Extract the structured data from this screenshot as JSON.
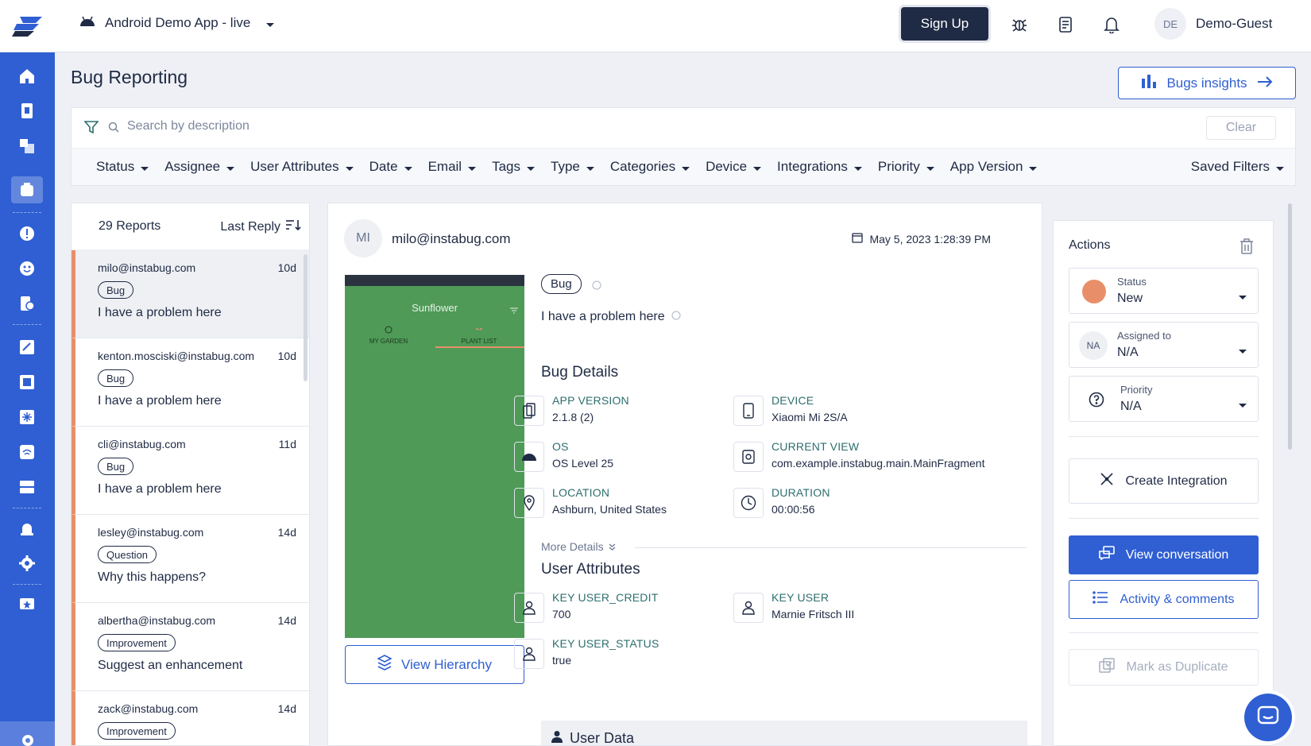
{
  "topbar": {
    "app_name": "Android Demo App - live",
    "signup_label": "Sign Up",
    "user_initials": "DE",
    "user_name": "Demo-Guest",
    "icons": [
      "bug-icon",
      "document-icon",
      "bell-icon"
    ]
  },
  "sidebar": {
    "items": [
      "home-icon",
      "report-icon",
      "copy-icon",
      "bug-reporting-icon",
      "crash-icon",
      "surveys-icon",
      "feature-requests-icon",
      "releases-icon",
      "apm-icon",
      "network-icon",
      "wifi-icon",
      "dashboard-icon",
      "alerts-icon",
      "settings-icon",
      "announcements-icon"
    ],
    "active": "bug-reporting-icon"
  },
  "header": {
    "title": "Bug Reporting",
    "insights_label": "Bugs insights"
  },
  "search": {
    "placeholder": "Search by description",
    "value": "",
    "clear_label": "Clear"
  },
  "filters": {
    "items": [
      "Status",
      "Assignee",
      "User Attributes",
      "Date",
      "Email",
      "Tags",
      "Type",
      "Categories",
      "Device",
      "Integrations",
      "Priority",
      "App Version"
    ],
    "saved_label": "Saved Filters"
  },
  "report_list": {
    "count_label": "29 Reports",
    "sort_label": "Last Reply",
    "items": [
      {
        "email": "milo@instabug.com",
        "age": "10d",
        "tag": "Bug",
        "text": "I have a problem here"
      },
      {
        "email": "kenton.mosciski@instabug.com",
        "age": "10d",
        "tag": "Bug",
        "text": "I have a problem here"
      },
      {
        "email": "cli@instabug.com",
        "age": "11d",
        "tag": "Bug",
        "text": "I have a problem here"
      },
      {
        "email": "lesley@instabug.com",
        "age": "14d",
        "tag": "Question",
        "text": "Why this happens?"
      },
      {
        "email": "albertha@instabug.com",
        "age": "14d",
        "tag": "Improvement",
        "text": "Suggest an enhancement"
      },
      {
        "email": "zack@instabug.com",
        "age": "14d",
        "tag": "Improvement",
        "text": ""
      }
    ]
  },
  "detail": {
    "avatar": "MI",
    "email": "milo@instabug.com",
    "date": "May 5, 2023 1:28:39 PM",
    "screenshot": {
      "app_title": "Sunflower",
      "tab_garden": "MY GARDEN",
      "tab_plants": "PLANT LIST",
      "color": "#4f9a57"
    },
    "view_hierarchy_label": "View Hierarchy",
    "tag": "Bug",
    "description": "I have a problem here",
    "bug_details_title": "Bug Details",
    "bug_details": [
      {
        "key": "APP VERSION",
        "value": "2.1.8 (2)",
        "icon": "phone-copy-icon"
      },
      {
        "key": "DEVICE",
        "value": "Xiaomi Mi 2S/A",
        "icon": "device-icon"
      },
      {
        "key": "OS",
        "value": "OS Level 25",
        "icon": "android-icon"
      },
      {
        "key": "CURRENT VIEW",
        "value": "com.example.instabug.main.MainFragment",
        "icon": "view-icon"
      },
      {
        "key": "LOCATION",
        "value": "Ashburn, United States",
        "icon": "location-pin-icon"
      },
      {
        "key": "DURATION",
        "value": "00:00:56",
        "icon": "clock-icon"
      }
    ],
    "more_details_label": "More Details",
    "user_attributes_title": "User Attributes",
    "user_attributes": [
      {
        "key": "KEY USER_CREDIT",
        "value": "700"
      },
      {
        "key": "KEY USER",
        "value": "Marnie Fritsch III"
      },
      {
        "key": "KEY USER_STATUS",
        "value": "true"
      }
    ],
    "user_data_title": "User Data"
  },
  "actions": {
    "title": "Actions",
    "status": {
      "label": "Status",
      "value": "New",
      "color": "#e88f6a"
    },
    "assigned": {
      "label": "Assigned to",
      "initials": "NA",
      "value": "N/A"
    },
    "priority": {
      "label": "Priority",
      "value": "N/A"
    },
    "create_integration_label": "Create Integration",
    "view_conversation_label": "View conversation",
    "activity_label": "Activity & comments",
    "duplicate_label": "Mark as Duplicate"
  },
  "colors": {
    "brand": "#2f5fd2",
    "dark": "#1f2a44",
    "accent": "#e88f6a"
  }
}
